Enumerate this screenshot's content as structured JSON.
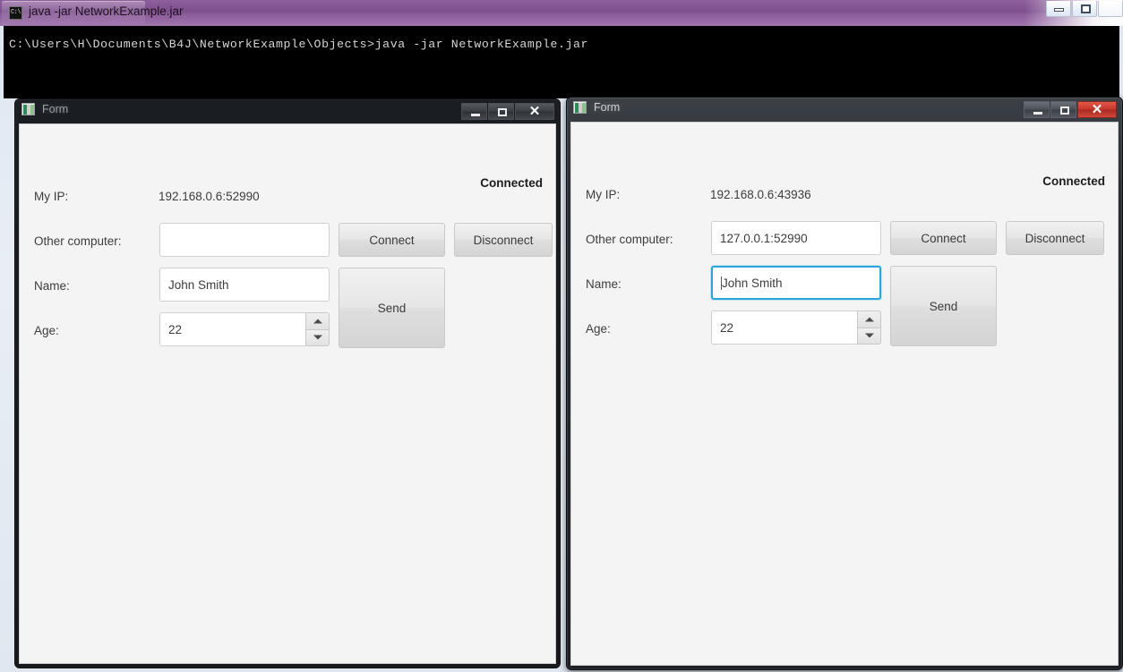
{
  "console": {
    "title": "java  -jar NetworkExample.jar",
    "icon": "console-icon",
    "icon_text": "C:\\",
    "command_line": "C:\\Users\\H\\Documents\\B4J\\NetworkExample\\Objects>java -jar NetworkExample.jar",
    "window_buttons": {
      "minimize": "minimize-icon",
      "maximize": "maximize-icon",
      "close": "close-icon"
    }
  },
  "left_form": {
    "title": "Form",
    "status": "Connected",
    "labels": {
      "my_ip": "My IP:",
      "other_computer": "Other computer:",
      "name": "Name:",
      "age": "Age:"
    },
    "values": {
      "my_ip": "192.168.0.6:52990",
      "other_computer": "",
      "other_computer_placeholder": "",
      "name": "John Smith",
      "age": "22"
    },
    "buttons": {
      "connect": "Connect",
      "disconnect": "Disconnect",
      "send": "Send"
    },
    "window_buttons": {
      "minimize": "minimize-icon",
      "maximize": "maximize-icon",
      "close": "✕"
    }
  },
  "right_form": {
    "title": "Form",
    "status": "Connected",
    "labels": {
      "my_ip": "My IP:",
      "other_computer": "Other computer:",
      "name": "Name:",
      "age": "Age:"
    },
    "values": {
      "my_ip": "192.168.0.6:43936",
      "other_computer": "127.0.0.1:52990",
      "other_computer_placeholder": "",
      "name": "John Smith",
      "age": "22"
    },
    "buttons": {
      "connect": "Connect",
      "disconnect": "Disconnect",
      "send": "Send"
    },
    "window_buttons": {
      "minimize": "minimize-icon",
      "maximize": "maximize-icon",
      "close": "✕"
    }
  },
  "colors": {
    "console_titlebar": "#7c4f8d",
    "console_body_bg": "#000000",
    "console_text": "#d6d6d6",
    "form_bg": "#f4f4f4",
    "focus_border": "#2aa5e0",
    "close_red": "#c6372b"
  }
}
